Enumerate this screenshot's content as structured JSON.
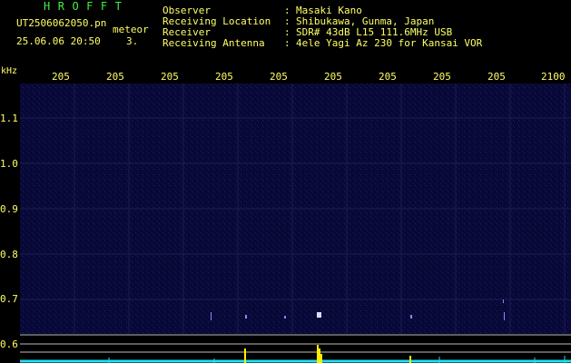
{
  "header": {
    "title": "HROFFT",
    "filename": "UT2506062050.pn",
    "suffix": "meteor",
    "datetime": "25.06.06 20:50",
    "count": "3.",
    "fields": [
      {
        "label": "Observer",
        "value": "Masaki Kano"
      },
      {
        "label": "Receiving Location",
        "value": "Shibukawa, Gunma, Japan"
      },
      {
        "label": "Receiver",
        "value": "SDR# 43dB L15 111.6MHz USB"
      },
      {
        "label": "Receiving Antenna",
        "value": "4ele Yagi Az 230 for Kansai VOR"
      }
    ],
    "separator": ":"
  },
  "axes": {
    "y_unit": "kHz",
    "x_ticks": [
      "205",
      "205",
      "205",
      "205",
      "205",
      "205",
      "205",
      "205",
      "205",
      "2100"
    ],
    "y_ticks": [
      "1.1",
      "1.0",
      "0.9",
      "0.8",
      "0.7",
      "0.6"
    ]
  },
  "colors": {
    "text": "#ffff66",
    "title": "#44ee44",
    "background": "#000000",
    "spectrogram": "#0a0a3c",
    "baseline_noise": "#22ddee",
    "meteor": "#ffee00"
  }
}
